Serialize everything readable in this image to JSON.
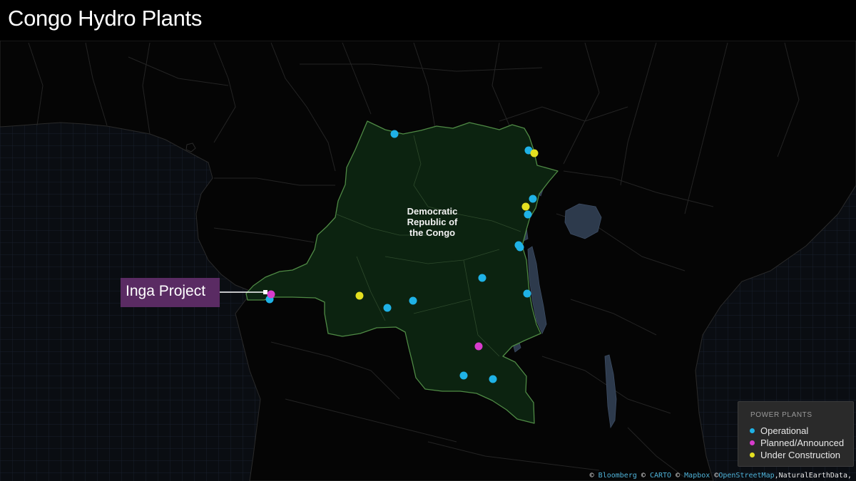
{
  "title": "Congo Hydro Plants",
  "country_label_lines": [
    "Democratic",
    "Republic of",
    "the Congo"
  ],
  "callout": {
    "label": "Inga Project"
  },
  "legend": {
    "title": "POWER PLANTS",
    "items": [
      {
        "label": "Operational",
        "color": "#1fb2e6"
      },
      {
        "label": "Planned/Announced",
        "color": "#d83ccd"
      },
      {
        "label": "Under Construction",
        "color": "#e4e020"
      }
    ]
  },
  "attribution": {
    "symbol": "©",
    "sources": [
      "Bloomberg",
      "CARTO",
      "Mapbox",
      "OpenStreetMap"
    ],
    "tail": ",NaturalEarthData,"
  },
  "colors": {
    "country_fill": "#0c2310",
    "country_border": "#4f8a45",
    "water": "#2d3a4c",
    "grid": "#1a2230",
    "borders": "#262626"
  }
}
